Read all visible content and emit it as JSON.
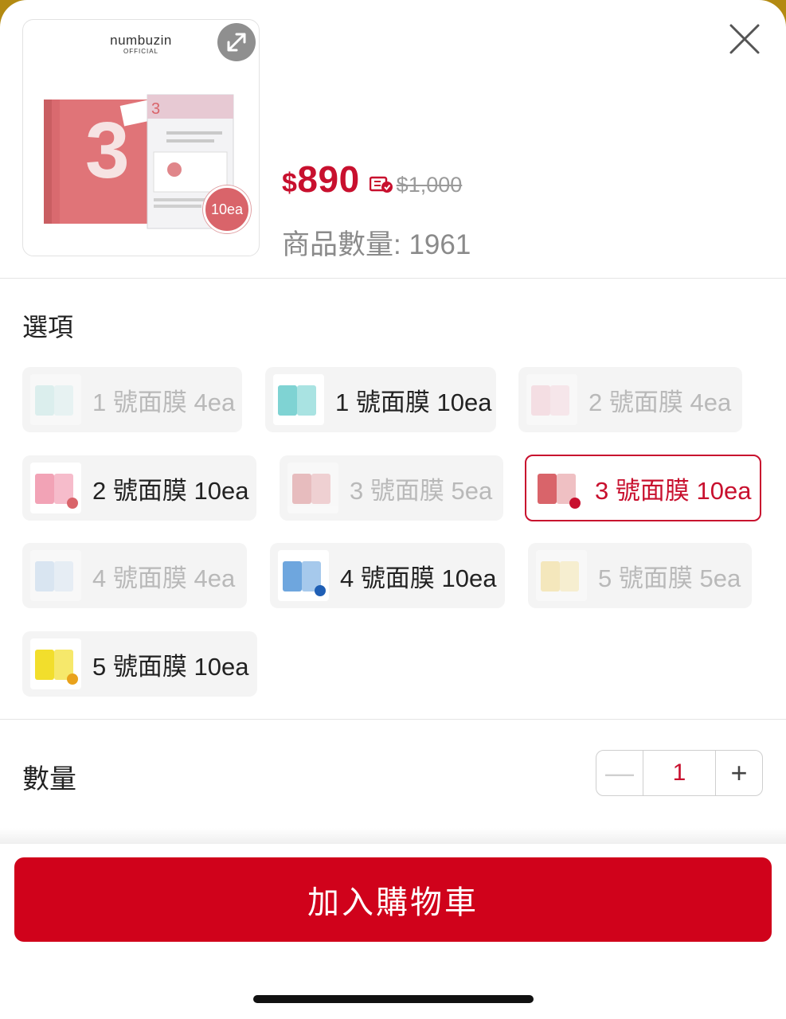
{
  "product": {
    "brand": "numbuzin",
    "brand_sub": "OFFICIAL",
    "image_tag": "10ea",
    "image_number": "3",
    "price_currency": "$",
    "price_value": "890",
    "original_price": "$1,000",
    "stock_text": "商品數量: 1961"
  },
  "options_section": {
    "title": "選項",
    "options": [
      {
        "label": "1 號面膜 4ea",
        "state": "disabled",
        "color": "#bfe7e6"
      },
      {
        "label": "1 號面膜 10ea",
        "state": "available",
        "color": "#7fd3d3"
      },
      {
        "label": "2 號面膜 4ea",
        "state": "disabled",
        "color": "#f6c4cf"
      },
      {
        "label": "2 號面膜 10ea",
        "state": "available",
        "color": "#f2a3b6"
      },
      {
        "label": "3 號面膜 5ea",
        "state": "disabled",
        "color": "#d97a7f"
      },
      {
        "label": "3 號面膜 10ea",
        "state": "selected",
        "color": "#d9646a"
      },
      {
        "label": "4 號面膜 4ea",
        "state": "disabled",
        "color": "#b9d3ee"
      },
      {
        "label": "4 號面膜 10ea",
        "state": "available",
        "color": "#6ea6de"
      },
      {
        "label": "5 號面膜 5ea",
        "state": "disabled",
        "color": "#f5d97a"
      },
      {
        "label": "5 號面膜 10ea",
        "state": "available",
        "color": "#f2de2c"
      }
    ]
  },
  "quantity_section": {
    "title": "數量",
    "value": "1",
    "minus": "—",
    "plus": "+"
  },
  "cta": {
    "label": "加入購物車"
  },
  "colors": {
    "accent": "#c8102e",
    "cta": "#d0021b"
  }
}
